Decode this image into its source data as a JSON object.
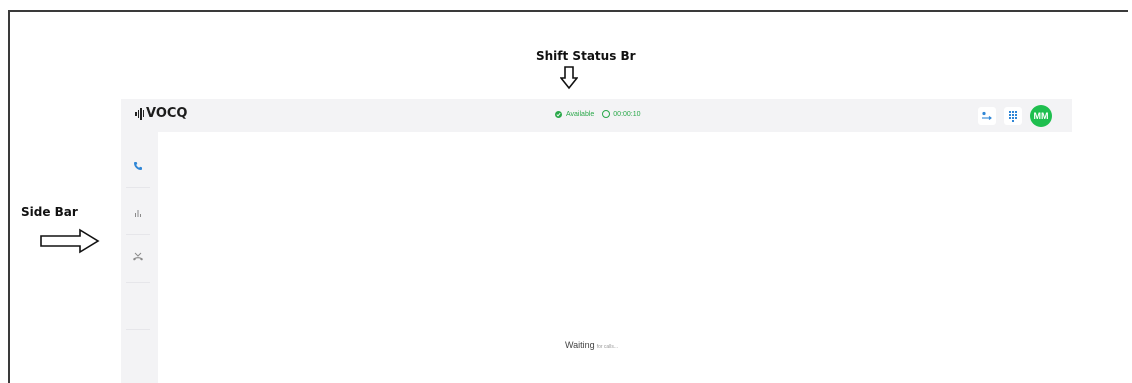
{
  "annotations": {
    "status_bar_label": "Shift Status Br",
    "side_bar_label": "Side Bar"
  },
  "app": {
    "logo_text": "VOCQ",
    "status": {
      "label": "Available",
      "timer": "00:00:10",
      "color": "#2aa84a"
    },
    "top_icons": [
      "transfer-icon",
      "dialpad-icon"
    ],
    "avatar_initials": "MM",
    "avatar_color": "#1fbf4f",
    "sidebar": {
      "items": [
        "phone-icon",
        "bar-chart-icon",
        "missed-call-icon"
      ],
      "accent": "#2f86d6"
    },
    "main": {
      "waiting_text": "Waiting",
      "waiting_subtext": "for calls..."
    }
  }
}
